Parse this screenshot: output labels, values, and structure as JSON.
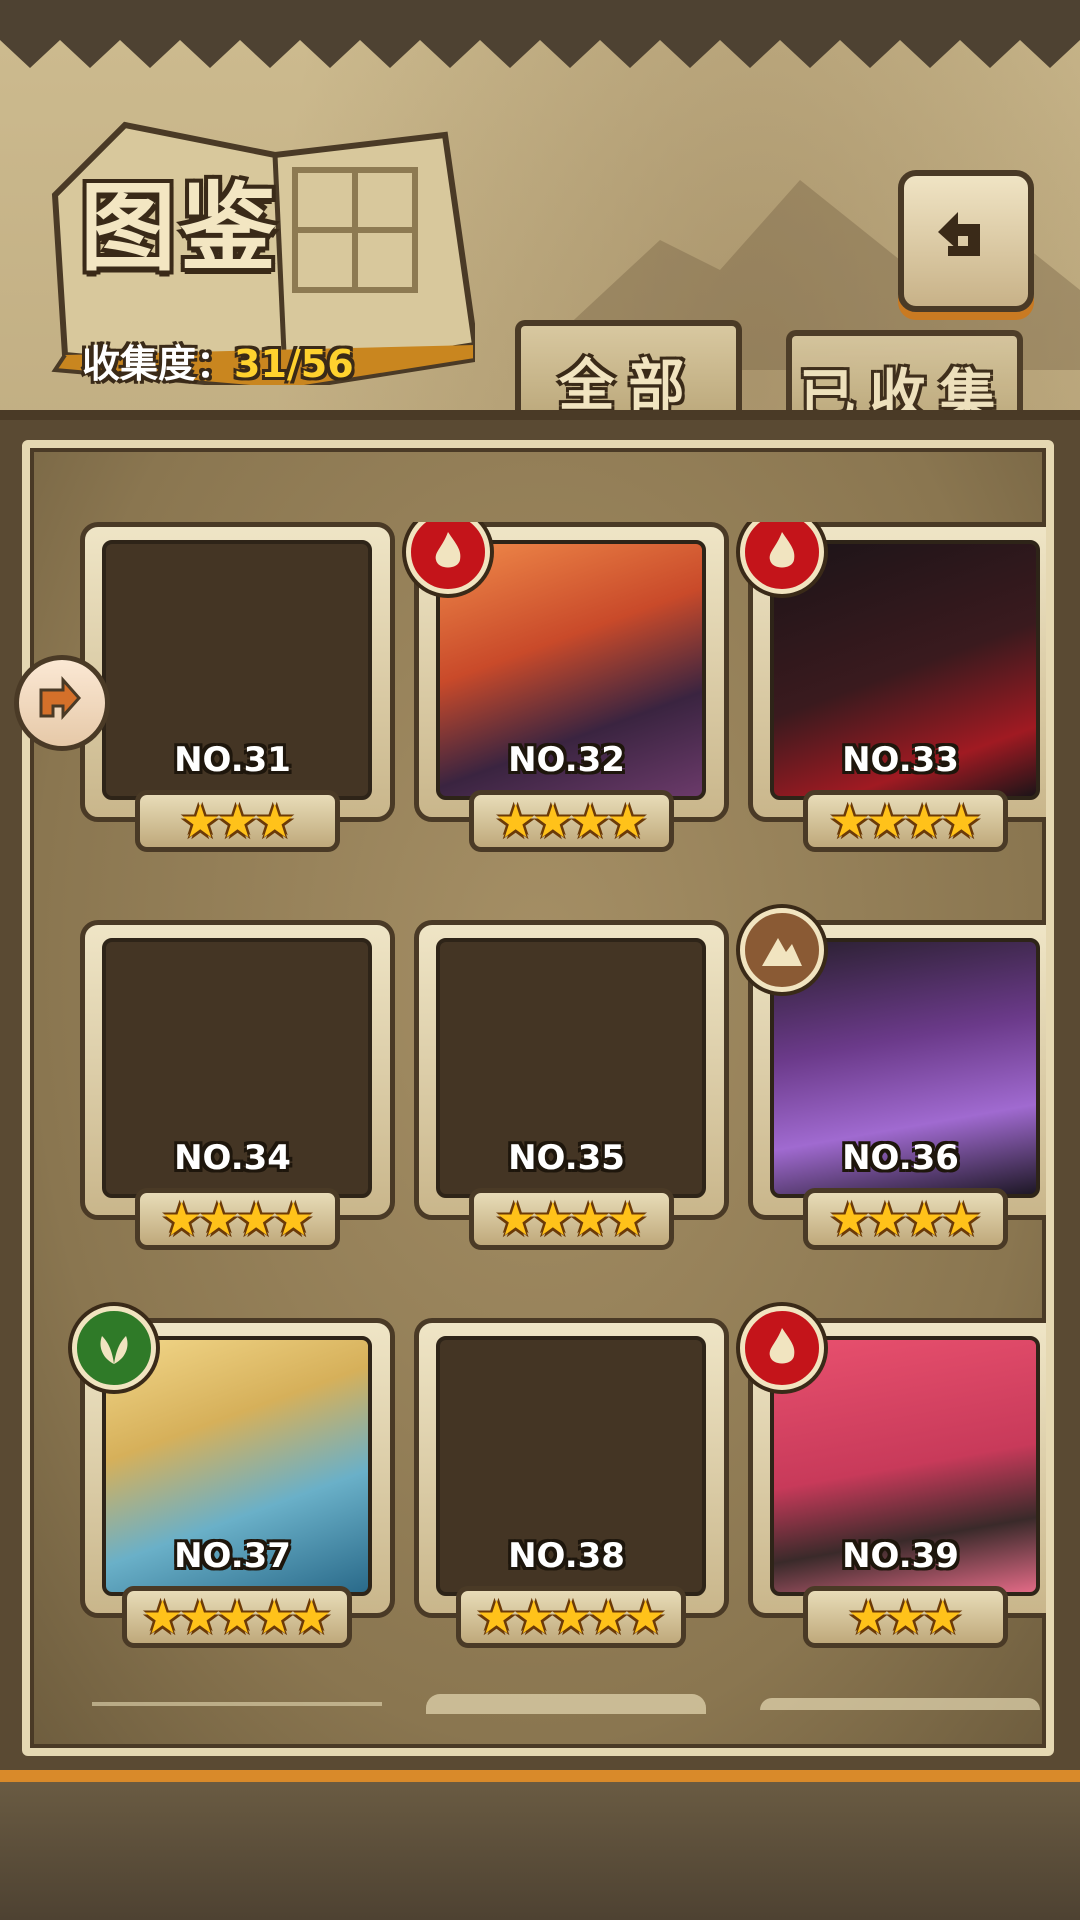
{
  "header": {
    "title": "图鉴",
    "collection_label": "收集度：",
    "collection_value": "31/56"
  },
  "tabs": [
    {
      "label": "全部",
      "active": true
    },
    {
      "label": "已收集",
      "active": false
    }
  ],
  "cards": [
    {
      "no": "NO.31",
      "stars": 3,
      "element": null,
      "unlocked": false
    },
    {
      "no": "NO.32",
      "stars": 4,
      "element": "fire",
      "unlocked": true
    },
    {
      "no": "NO.33",
      "stars": 4,
      "element": "fire",
      "unlocked": true
    },
    {
      "no": "NO.34",
      "stars": 4,
      "element": null,
      "unlocked": false
    },
    {
      "no": "NO.35",
      "stars": 4,
      "element": null,
      "unlocked": false
    },
    {
      "no": "NO.36",
      "stars": 4,
      "element": "earth",
      "unlocked": true
    },
    {
      "no": "NO.37",
      "stars": 5,
      "element": "wood",
      "unlocked": true
    },
    {
      "no": "NO.38",
      "stars": 5,
      "element": null,
      "unlocked": false
    },
    {
      "no": "NO.39",
      "stars": 3,
      "element": "fire",
      "unlocked": true
    }
  ],
  "icons": {
    "back": "back-arrow-icon",
    "side": "direction-arrow-icon",
    "fire": "fire-element-icon",
    "wood": "leaf-element-icon",
    "earth": "mountain-element-icon"
  },
  "colors": {
    "star": "#ffc21a",
    "fire": "#c4141a",
    "wood": "#2f7a28",
    "earth": "#8a5a34",
    "accent_orange": "#d98a2a",
    "collection_value": "#ffd22e"
  }
}
